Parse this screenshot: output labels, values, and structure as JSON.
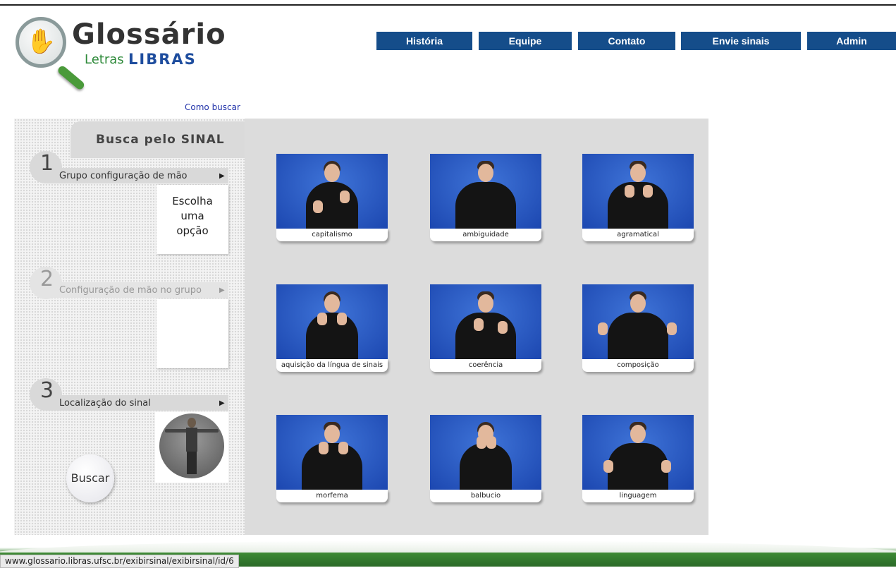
{
  "logo": {
    "title": "Glossário",
    "sub1": "Letras",
    "sub2": "LIBRAS",
    "icon": "magnifier-hand-icon"
  },
  "nav": [
    "História",
    "Equipe",
    "Contato",
    "Envie sinais",
    "Admin"
  ],
  "help_link": "Como buscar",
  "search": {
    "title": "Busca pelo SINAL",
    "steps": [
      {
        "number": "1",
        "label": "Grupo configuração de mão"
      },
      {
        "number": "2",
        "label": "Configuração de mão no grupo"
      },
      {
        "number": "3",
        "label": "Localização do sinal"
      }
    ],
    "choose_text": [
      "Escolha",
      "uma",
      "opção"
    ],
    "button": "Buscar"
  },
  "signs": [
    "capitalismo",
    "ambiguidade",
    "agramatical",
    "aquisição da língua de sinais",
    "coerência",
    "composição",
    "morfema",
    "balbucio",
    "linguagem"
  ],
  "status_bar": "www.glossario.libras.ufsc.br/exibirsinal/exibirsinal/id/6",
  "colors": {
    "nav_bg": "#154d8a",
    "card_bg": "#2a5cc4",
    "footer_green": "#3d8a34"
  }
}
